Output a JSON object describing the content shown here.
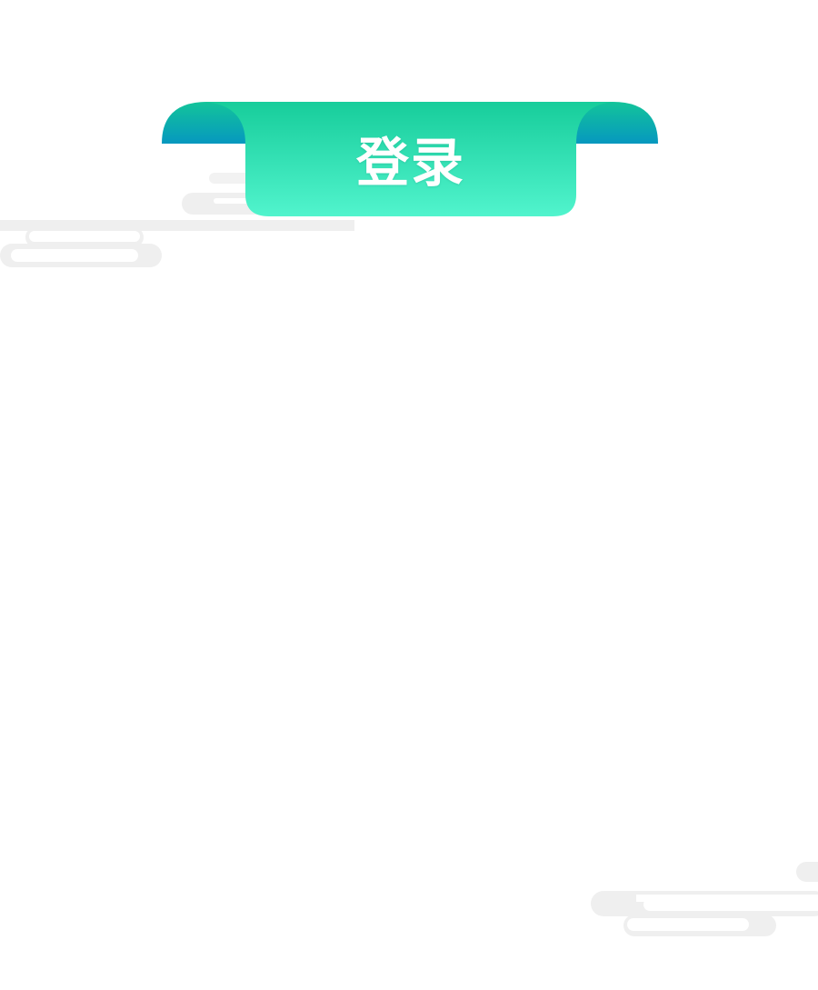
{
  "header": {
    "title": "登录"
  },
  "colors": {
    "ribbon_top": "#17CD9B",
    "ribbon_bottom": "#51F4CD",
    "fold_light": "#13C49A",
    "fold_dark": "#0698BF",
    "cloud": "#EFEFEF",
    "cloud_line": "#FFFFFF"
  }
}
